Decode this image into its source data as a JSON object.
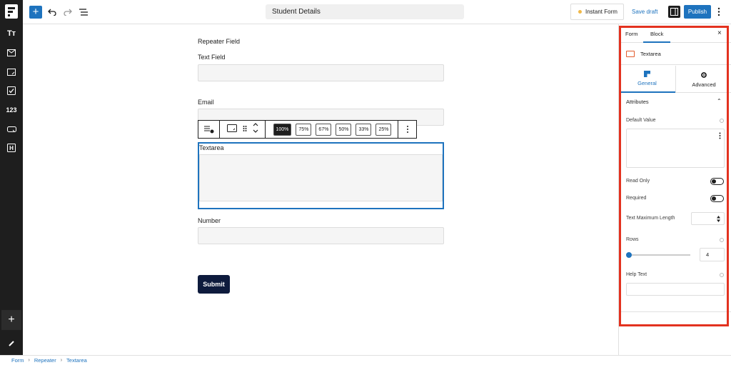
{
  "topbar": {
    "document_title": "Student Details",
    "instant_form_label": "Instant Form",
    "save_draft_label": "Save draft",
    "publish_label": "Publish"
  },
  "sidebar": {
    "items": [
      {
        "icon": "heading-icon",
        "label": "Tт"
      },
      {
        "icon": "email-icon"
      },
      {
        "icon": "textarea-icon"
      },
      {
        "icon": "checkbox-icon"
      },
      {
        "icon": "number-icon",
        "label": "123"
      },
      {
        "icon": "button-icon"
      },
      {
        "icon": "hidden-field-icon",
        "label": "H"
      }
    ],
    "add_label": "+"
  },
  "form": {
    "repeater_label": "Repeater Field",
    "text_field_label": "Text Field",
    "email_label": "Email",
    "textarea_label": "Textarea",
    "number_label": "Number",
    "submit_label": "Submit"
  },
  "block_toolbar": {
    "widths": [
      "100%",
      "75%",
      "67%",
      "50%",
      "33%",
      "25%"
    ],
    "active_width": "100%"
  },
  "panel": {
    "tabs": {
      "form": "Form",
      "block": "Block"
    },
    "close": "×",
    "block_name": "Textarea",
    "subtabs": {
      "general": "General",
      "advanced": "Advanced"
    },
    "attributes_header": "Attributes",
    "default_value_label": "Default Value",
    "read_only_label": "Read Only",
    "read_only_value": false,
    "required_label": "Required",
    "required_value": false,
    "text_max_length_label": "Text Maximum Length",
    "rows_label": "Rows",
    "rows_value": "4",
    "help_text_label": "Help Text"
  },
  "breadcrumb": {
    "items": [
      "Form",
      "Repeater",
      "Textarea"
    ]
  },
  "colors": {
    "accent": "#1e73be",
    "sidebar_bg": "#1e1e1e",
    "highlight_outline": "#e3321f",
    "submit_bg": "#0e1b3d"
  }
}
